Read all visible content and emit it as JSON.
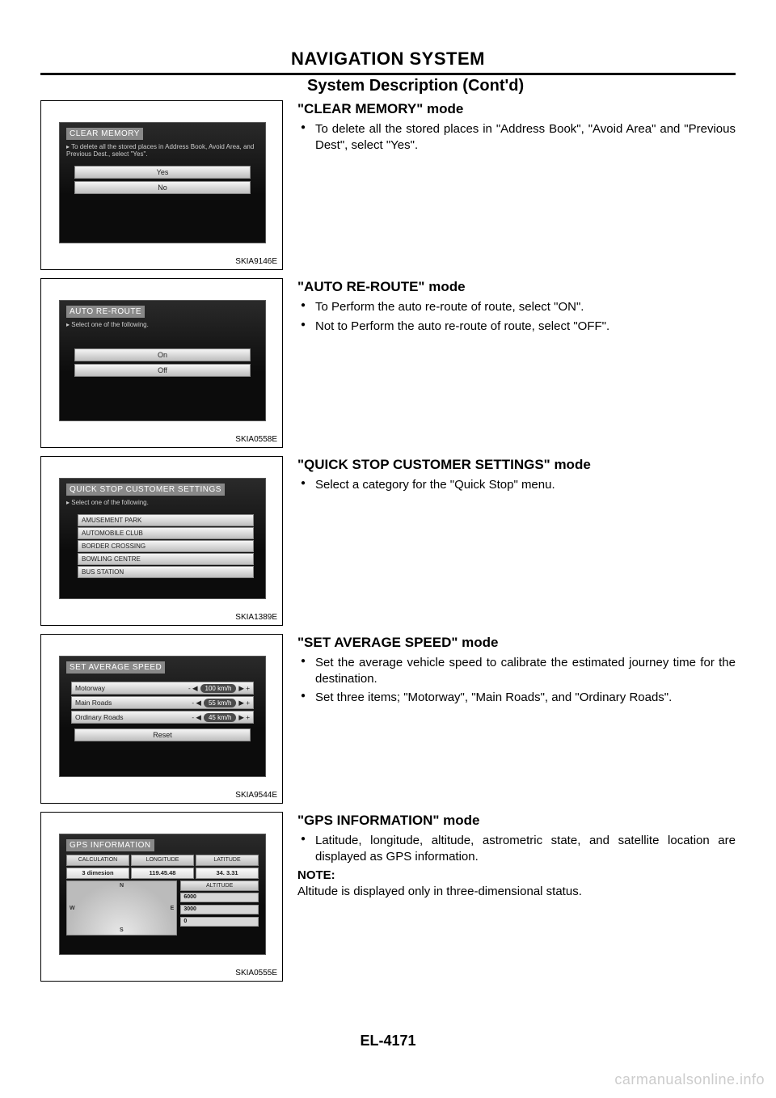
{
  "header": {
    "title": "NAVIGATION SYSTEM",
    "subtitle": "System Description (Cont'd)"
  },
  "sections": {
    "clear_memory": {
      "title": "\"CLEAR MEMORY\" mode",
      "bullet1": "To delete all the stored places in \"Address Book\", \"Avoid Area\" and \"Previous Dest\", select \"Yes\".",
      "fig_code": "SKIA9146E",
      "screen_title": "CLEAR MEMORY",
      "screen_tip": "▸ To delete all the stored places in Address Book, Avoid Area, and Previous Dest., select \"Yes\".",
      "btn_yes": "Yes",
      "btn_no": "No"
    },
    "auto_reroute": {
      "title": "\"AUTO RE-ROUTE\" mode",
      "bullet1": "To Perform the auto re-route of route, select \"ON\".",
      "bullet2": "Not to Perform the auto re-route of route, select \"OFF\".",
      "fig_code": "SKIA0558E",
      "screen_title": "AUTO RE-ROUTE",
      "screen_tip": "▸ Select one of the following.",
      "btn_on": "On",
      "btn_off": "Off"
    },
    "quick_stop": {
      "title": "\"QUICK STOP CUSTOMER SETTINGS\" mode",
      "bullet1": "Select a category for the \"Quick Stop\" menu.",
      "fig_code": "SKIA1389E",
      "screen_title": "QUICK STOP CUSTOMER SETTINGS",
      "screen_tip": "▸ Select one of the following.",
      "items": [
        "AMUSEMENT PARK",
        "AUTOMOBILE CLUB",
        "BORDER CROSSING",
        "BOWLING CENTRE",
        "BUS STATION"
      ]
    },
    "avg_speed": {
      "title": "\"SET AVERAGE SPEED\" mode",
      "bullet1": "Set the average vehicle speed to calibrate the estimated journey time for the destination.",
      "bullet2": "Set three items; \"Motorway\", \"Main Roads\", and \"Ordinary Roads\".",
      "fig_code": "SKIA9544E",
      "screen_title": "SET AVERAGE SPEED",
      "rows": [
        {
          "label": "Motorway",
          "value": "100 km/h"
        },
        {
          "label": "Main Roads",
          "value": "55 km/h"
        },
        {
          "label": "Ordinary Roads",
          "value": "45 km/h"
        }
      ],
      "reset": "Reset"
    },
    "gps_info": {
      "title": "\"GPS INFORMATION\" mode",
      "bullet1": "Latitude, longitude, altitude, astrometric state, and satellite location are displayed as GPS information.",
      "note_label": "NOTE:",
      "note_text": "Altitude is displayed only in three-dimensional status.",
      "fig_code": "SKIA0555E",
      "screen_title": "GPS INFORMATION",
      "headers": [
        "CALCULATION",
        "LONGITUDE",
        "LATITUDE"
      ],
      "values": [
        "3 dimesion",
        "119.45.48",
        "34. 3.31"
      ],
      "altitude_label": "ALTITUDE",
      "alt_ticks": [
        "6000",
        "3000",
        "0"
      ],
      "compass": {
        "n": "N",
        "s": "S",
        "e": "E",
        "w": "W"
      }
    }
  },
  "page_number": "EL-4171",
  "watermark": "carmanualsonline.info"
}
